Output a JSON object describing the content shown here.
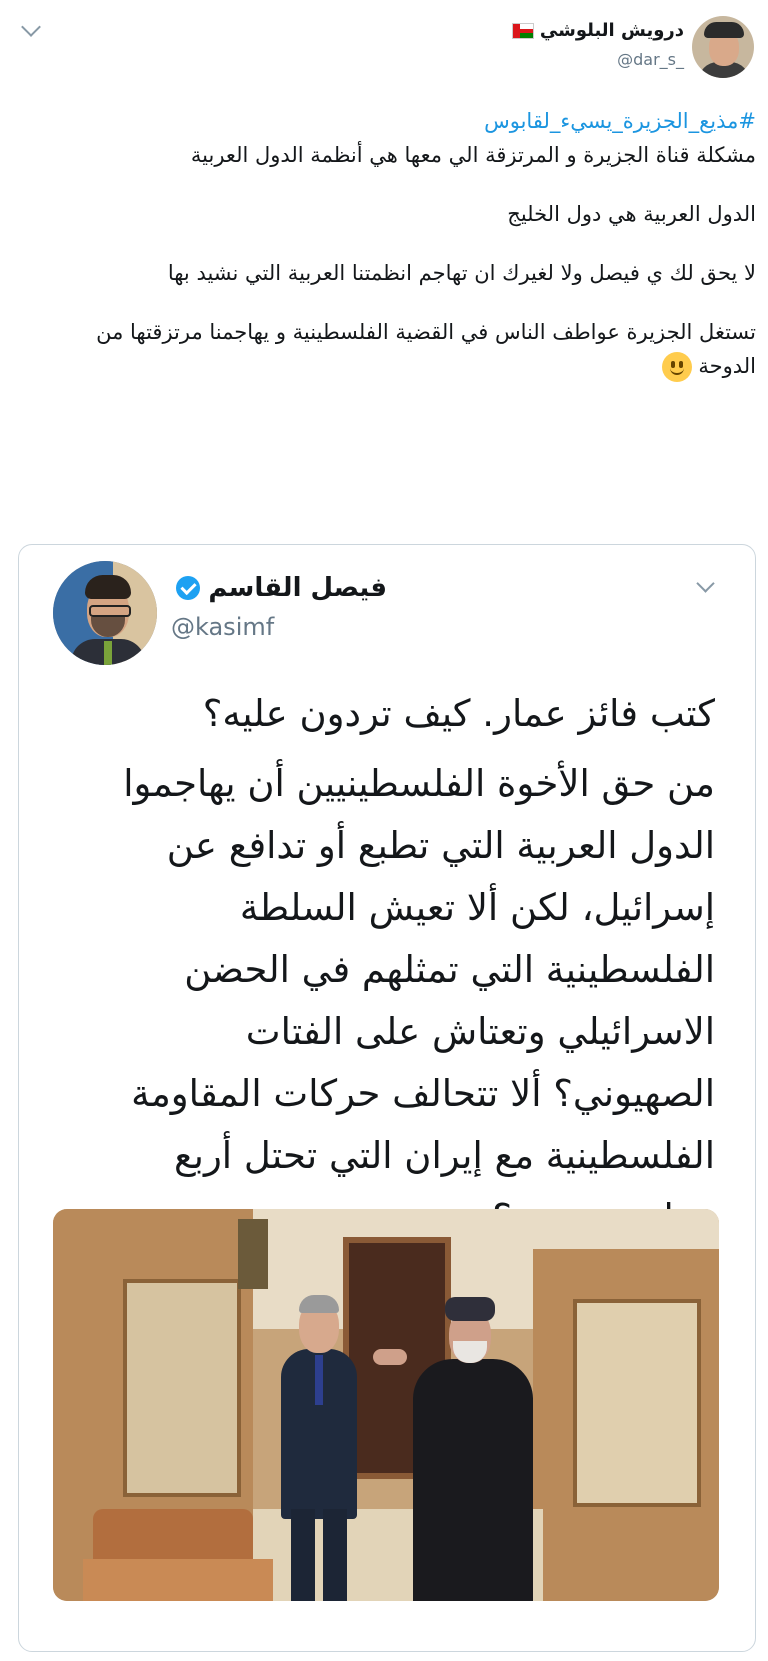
{
  "tweet": {
    "author_name": "درويش البلوشي",
    "author_handle": "@dar_s_",
    "hashtag": "#مذيع_الجزيرة_يسيء_لقابوس",
    "paragraphs": [
      "مشكلة قناة الجزيرة و المرتزقة الي معها هي أنظمة الدول العربية",
      "الدول العربية هي دول الخليج",
      "لا يحق لك ي فيصل ولا لغيرك ان تهاجم انظمتنا العربية التي نشيد بها",
      "تستغل الجزيرة عواطف الناس في القضية الفلسطينية و يهاجمنا مرتزقتها من الدوحة"
    ],
    "emoji": "slightly-smiling-face"
  },
  "quoted_tweet": {
    "author_name": "فيصل القاسم",
    "author_handle": "@kasimf",
    "verified": true,
    "lines": [
      "كتب فائز عمار. كيف تردون عليه؟",
      "من حق الأخوة الفلسطينيين أن يهاجموا الدول العربية التي تطبع أو تدافع عن إسرائيل، لكن ألا تعيش السلطة الفلسطينية التي تمثلهم في الحضن الاسرائيلي وتعتاش على الفتات الصهيوني؟ ألا تتحالف حركات المقاومة الفلسطينية مع إيران التي تحتل أربع عواصم عربية؟"
    ]
  },
  "icons": {
    "menu": "chevron-down-icon",
    "verified": "verified-badge-icon",
    "flag": "oman-flag-icon"
  },
  "colors": {
    "link": "#1b95e0",
    "verified": "#1da1f2",
    "secondary_text": "#657786",
    "border": "#ccd6dd"
  }
}
